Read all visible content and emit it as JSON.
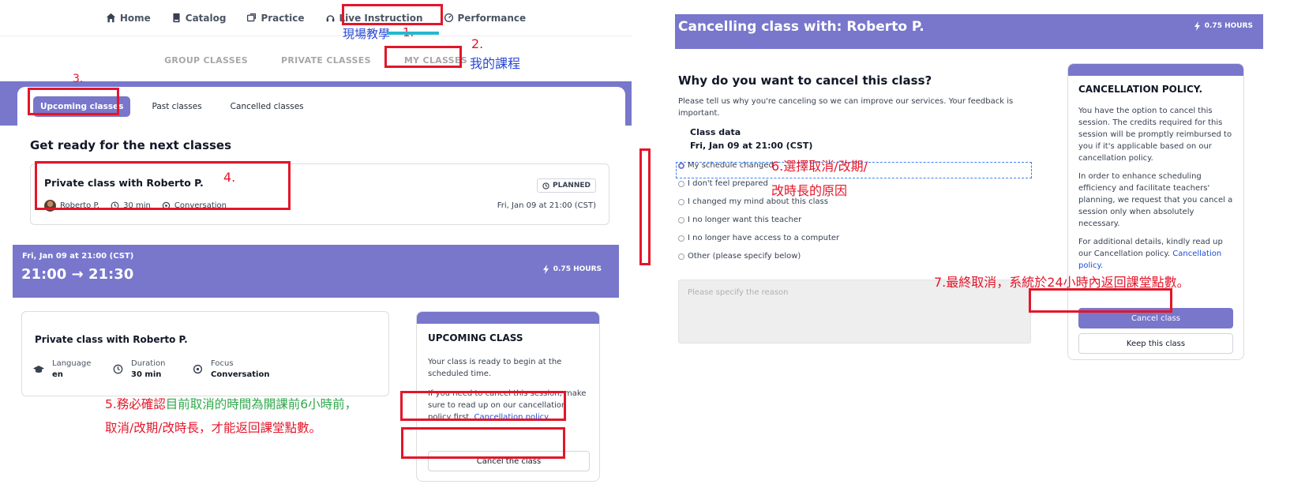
{
  "left": {
    "nav": {
      "items": [
        {
          "label": "Home",
          "icon": "home-icon"
        },
        {
          "label": "Catalog",
          "icon": "book-icon"
        },
        {
          "label": "Practice",
          "icon": "practice-icon"
        },
        {
          "label": "Live Instruction",
          "icon": "headset-icon"
        },
        {
          "label": "Performance",
          "icon": "gauge-icon"
        }
      ]
    },
    "subnav": [
      "GROUP CLASSES",
      "PRIVATE CLASSES",
      "MY CLASSES"
    ],
    "tabs": [
      "Upcoming classes",
      "Past classes",
      "Cancelled classes"
    ],
    "section_title": "Get ready for the next classes",
    "class_card": {
      "title": "Private class with Roberto P.",
      "teacher": "Roberto P.",
      "duration": "30 min",
      "topic": "Conversation",
      "status": "PLANNED",
      "datetime": "Fri, Jan 09 at 21:00 (CST)"
    },
    "time_band": {
      "date": "Fri, Jan 09 at 21:00 (CST)",
      "start": "21:00",
      "arrow": "→",
      "end": "21:30",
      "hours": "0.75 HOURS"
    },
    "details": {
      "title": "Private class with Roberto P.",
      "language_label": "Language",
      "language_value": "en",
      "duration_label": "Duration",
      "duration_value": "30 min",
      "focus_label": "Focus",
      "focus_value": "Conversation"
    },
    "upcoming": {
      "title": "UPCOMING CLASS",
      "p1": "Your class is ready to begin at the scheduled time.",
      "p2_text": "If you need to cancel this session, make sure to read up on our cancellation policy first.",
      "p2_link": "Cancellation policy.",
      "button": "Cancel the class"
    },
    "annotations": {
      "n1_text": "現場教學",
      "n1_num": "1.",
      "n2_num": "2.",
      "n2_text": "我的課程",
      "n3": "3.",
      "n4": "4.",
      "n5_a": "5.務必確認",
      "n5_b": "目前取消的時間為開課前6小時前，",
      "n5_c": "取消/改期/改時長，才能返回課堂點數。"
    }
  },
  "right": {
    "header_title": "Cancelling class with: Roberto P.",
    "hours": "0.75 HOURS",
    "question": "Why do you want to cancel this class?",
    "help": "Please tell us why you're canceling so we can improve our services. Your feedback is important.",
    "class_data_label": "Class data",
    "class_data_value": "Fri, Jan 09 at 21:00 (CST)",
    "reasons": [
      "My schedule changed",
      "I don't feel prepared",
      "I changed my mind about this class",
      "I no longer want this teacher",
      "I no longer have access to a computer",
      "Other (please specify below)"
    ],
    "selected_reason": "My schedule changed",
    "specify_placeholder": "Please specify the reason",
    "policy": {
      "title": "CANCELLATION POLICY.",
      "p1": "You have the option to cancel this session. The credits required for this session will be promptly reimbursed to you if it's applicable based on our cancellation policy.",
      "p2": "In order to enhance scheduling efficiency and facilitate teachers' planning, we request that you cancel a session only when absolutely necessary.",
      "p3_text": "For additional details, kindly read up our Cancellation policy.",
      "p3_link": "Cancellation policy.",
      "cancel_button": "Cancel class",
      "keep_button": "Keep this class"
    },
    "annotations": {
      "n6_a": "6.選擇取消/改期/",
      "n6_b": "改時長的原因",
      "n7": "7.最終取消，系統於24小時內返回課堂點數。"
    }
  },
  "colors": {
    "accent": "#7877cc",
    "annotation_red": "#e3162a",
    "annotation_blue": "#2748d8",
    "annotation_green": "#2ea84a",
    "link": "#1d4ed8"
  }
}
